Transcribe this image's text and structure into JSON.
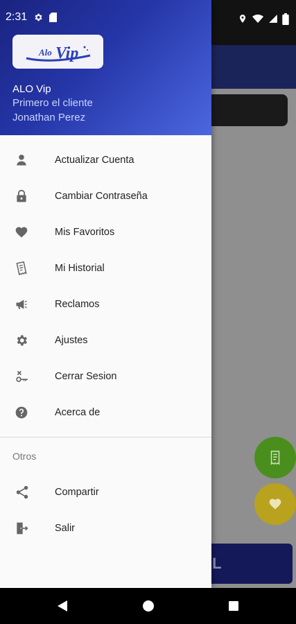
{
  "status_bar": {
    "time": "2:31"
  },
  "drawer": {
    "app_name": "ALO Vip",
    "tagline": "Primero el cliente",
    "user_name": "Jonathan Perez",
    "logo": {
      "alo": "Alo",
      "vip": "Vip"
    },
    "menu": [
      {
        "label": "Actualizar Cuenta",
        "icon": "person-icon"
      },
      {
        "label": "Cambiar Contraseña",
        "icon": "lock-icon"
      },
      {
        "label": "Mis Favoritos",
        "icon": "heart-icon"
      },
      {
        "label": "Mi Historial",
        "icon": "receipt-icon"
      },
      {
        "label": "Reclamos",
        "icon": "megaphone-icon"
      },
      {
        "label": "Ajustes",
        "icon": "gear-icon"
      },
      {
        "label": "Cerrar Sesion",
        "icon": "logout-key-icon"
      },
      {
        "label": "Acerca de",
        "icon": "help-icon"
      }
    ],
    "section_label": "Otros",
    "other": [
      {
        "label": "Compartir",
        "icon": "share-icon"
      },
      {
        "label": "Salir",
        "icon": "exit-icon"
      }
    ]
  },
  "background": {
    "button_text": "IL"
  },
  "colors": {
    "header_start": "#1a2380",
    "header_end": "#4c67e0",
    "fab_green": "#4a8f1e",
    "fab_yellow": "#b9a21e"
  }
}
